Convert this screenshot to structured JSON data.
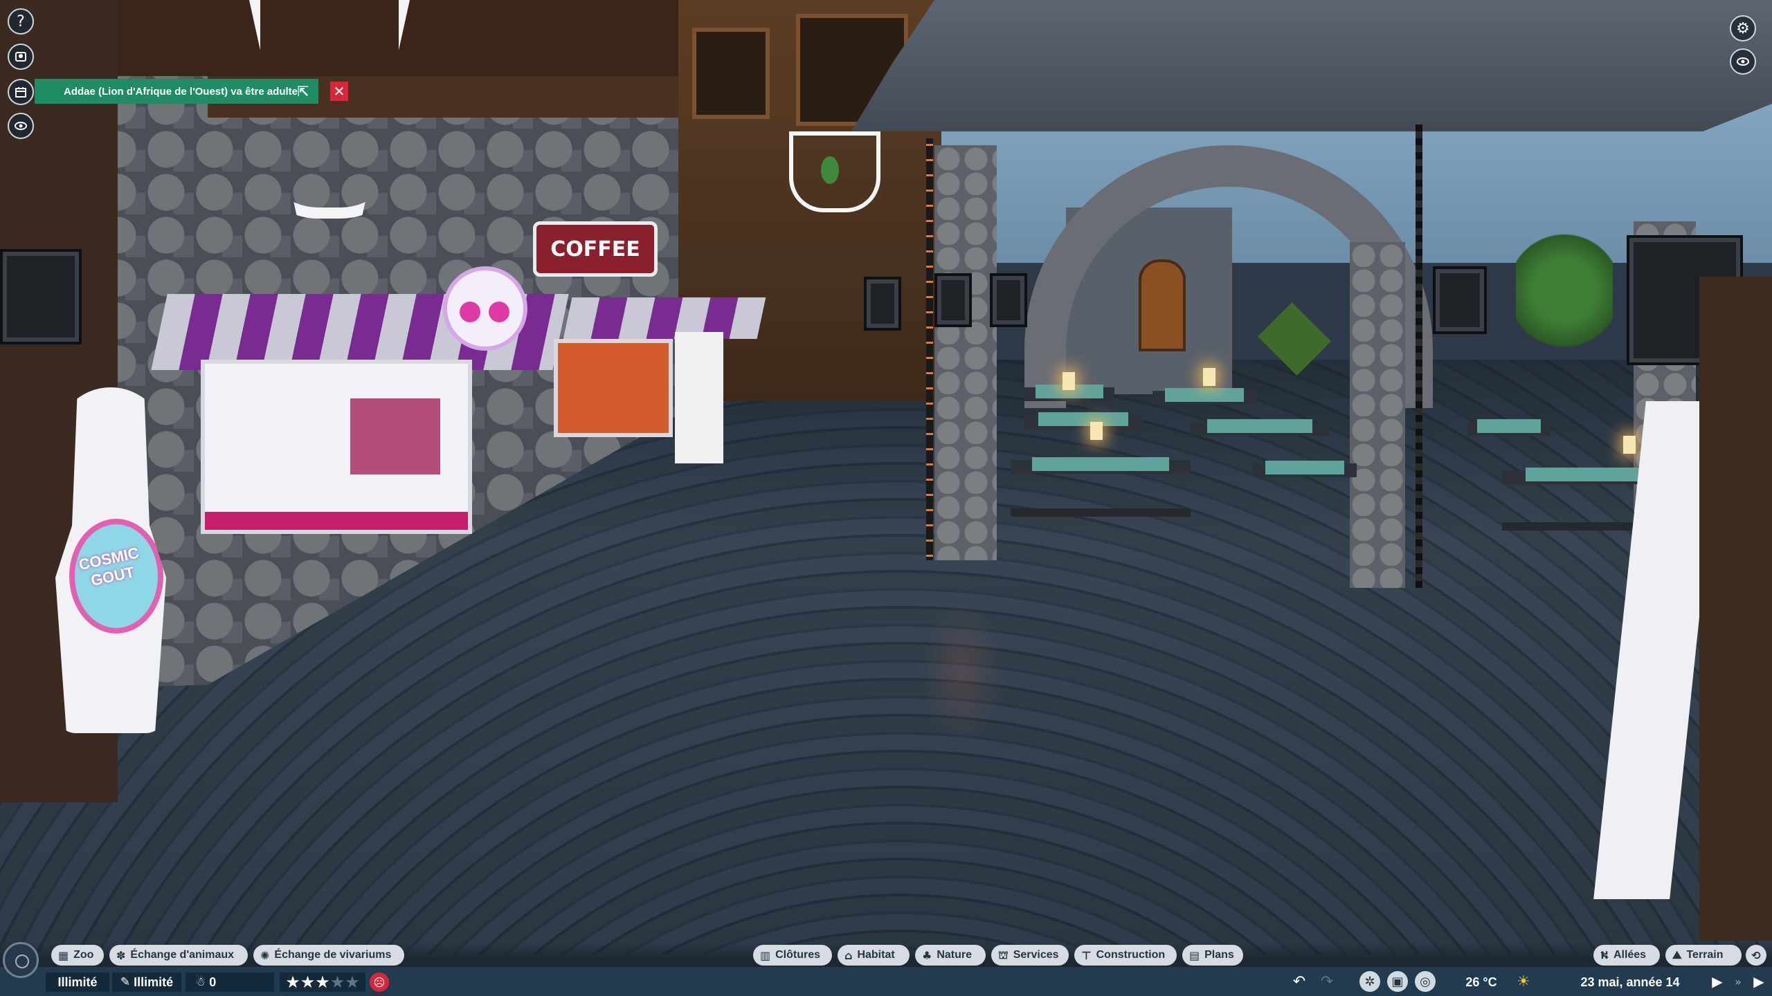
{
  "notification": {
    "text": "Addae (Lion d'Afrique de l'Ouest) va être adulte",
    "external_icon": "external-link-icon",
    "close_icon": "close-icon",
    "color": "#1f8c63"
  },
  "left_toolbar": {
    "help_glyph": "?",
    "items": [
      "help-icon",
      "animal-profile-icon",
      "calendar-icon",
      "visibility-icon"
    ]
  },
  "right_toolbar": {
    "items": [
      "settings-gear-icon",
      "camera-view-icon"
    ]
  },
  "scene_text": {
    "coffee_sign": "COFFEE",
    "milkshake_sign": "COSMIC GOUT"
  },
  "bottom_left_menu": [
    {
      "label": "Zoo",
      "icon": "zoo-icon"
    },
    {
      "label": "Échange d'animaux",
      "icon": "paw-icon"
    },
    {
      "label": "Échange de vivariums",
      "icon": "vivarium-icon"
    }
  ],
  "bottom_center_menu": [
    {
      "label": "Clôtures",
      "icon": "fence-icon"
    },
    {
      "label": "Habitat",
      "icon": "habitat-icon"
    },
    {
      "label": "Nature",
      "icon": "tree-icon"
    },
    {
      "label": "Services",
      "icon": "shop-icon"
    },
    {
      "label": "Construction",
      "icon": "build-icon"
    },
    {
      "label": "Plans",
      "icon": "blueprint-icon"
    }
  ],
  "bottom_right_menu": [
    {
      "label": "Allées",
      "icon": "path-icon"
    },
    {
      "label": "Terrain",
      "icon": "terrain-icon"
    }
  ],
  "status": {
    "money": "Illimité",
    "research": "Illimité",
    "guests": "0",
    "rating_stars": 3,
    "rating_max": 5,
    "guest_mood_icon": "unhappy-face-icon",
    "temperature": "26 °C",
    "weather_icon": "sun-icon",
    "date": "23 mai, année 14"
  },
  "colors": {
    "hud_bar": "#223e54",
    "pill": "#e6ecf0",
    "alert_red": "#d7263d"
  }
}
